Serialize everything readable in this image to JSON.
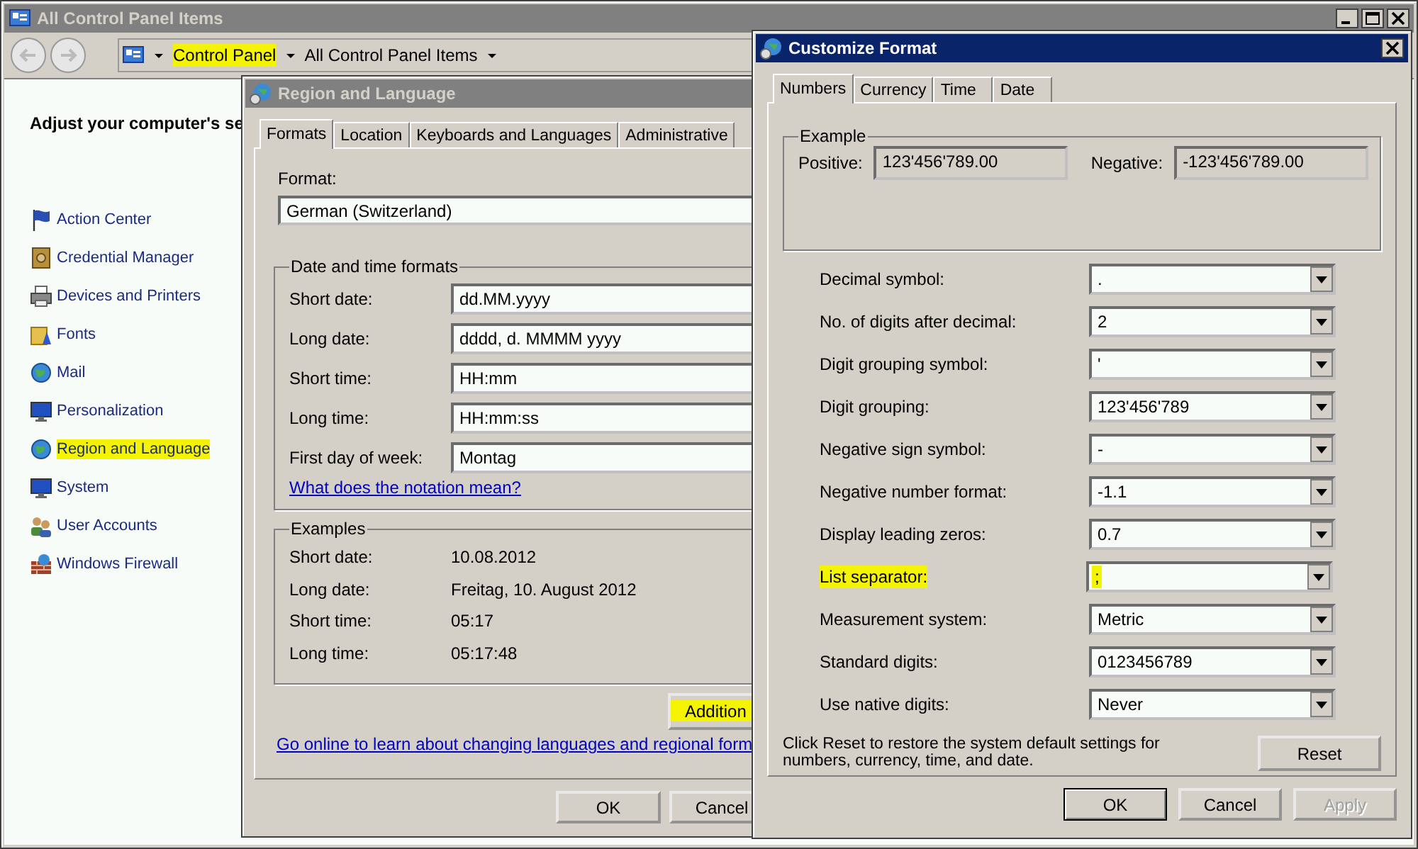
{
  "main_window": {
    "title": "All Control Panel Items",
    "active": false,
    "breadcrumb": [
      {
        "label": "Control Panel",
        "highlighted": true
      },
      {
        "label": "All Control Panel Items",
        "highlighted": false
      }
    ],
    "heading": "Adjust your computer's se",
    "items": [
      {
        "label": "Action Center",
        "highlighted": false
      },
      {
        "label": "Credential Manager",
        "highlighted": false
      },
      {
        "label": "Devices and Printers",
        "highlighted": false
      },
      {
        "label": "Fonts",
        "highlighted": false
      },
      {
        "label": "Mail",
        "highlighted": false
      },
      {
        "label": "Personalization",
        "highlighted": false
      },
      {
        "label": "Region and Language",
        "highlighted": true
      },
      {
        "label": "System",
        "highlighted": false
      },
      {
        "label": "User Accounts",
        "highlighted": false
      },
      {
        "label": "Windows Firewall",
        "highlighted": false
      }
    ]
  },
  "region_dialog": {
    "title": "Region and Language",
    "active": false,
    "tabs": [
      {
        "label": "Formats",
        "selected": true
      },
      {
        "label": "Location",
        "selected": false
      },
      {
        "label": "Keyboards and Languages",
        "selected": false
      },
      {
        "label": "Administrative",
        "selected": false
      }
    ],
    "format_label": "Format:",
    "format_value": "German (Switzerland)",
    "formats_group": {
      "title": "Date and time formats",
      "rows": [
        {
          "label": "Short date:",
          "value": "dd.MM.yyyy"
        },
        {
          "label": "Long date:",
          "value": "dddd, d. MMMM yyyy"
        },
        {
          "label": "Short time:",
          "value": "HH:mm"
        },
        {
          "label": "Long time:",
          "value": "HH:mm:ss"
        },
        {
          "label": "First day of week:",
          "value": "Montag"
        }
      ],
      "link": "What does the notation mean?"
    },
    "examples_group": {
      "title": "Examples",
      "rows": [
        {
          "label": "Short date:",
          "value": "10.08.2012"
        },
        {
          "label": "Long date:",
          "value": "Freitag, 10. August 2012"
        },
        {
          "label": "Short time:",
          "value": "05:17"
        },
        {
          "label": "Long time:",
          "value": "05:17:48"
        }
      ]
    },
    "additional_button": {
      "label": "Addition",
      "highlighted": true
    },
    "online_link": "Go online to learn about changing languages and regional form",
    "buttons": [
      {
        "label": "OK"
      },
      {
        "label": "Cancel"
      }
    ]
  },
  "customize_dialog": {
    "title": "Customize Format",
    "active": true,
    "tabs": [
      {
        "label": "Numbers",
        "selected": true
      },
      {
        "label": "Currency",
        "selected": false
      },
      {
        "label": "Time",
        "selected": false
      },
      {
        "label": "Date",
        "selected": false
      }
    ],
    "example_group": {
      "title": "Example",
      "positive_label": "Positive:",
      "positive_value": "123'456'789.00",
      "negative_label": "Negative:",
      "negative_value": "-123'456'789.00"
    },
    "settings": [
      {
        "label": "Decimal symbol:",
        "value": ".",
        "highlighted": false
      },
      {
        "label": "No. of digits after decimal:",
        "value": "2",
        "highlighted": false
      },
      {
        "label": "Digit grouping symbol:",
        "value": "'",
        "highlighted": false
      },
      {
        "label": "Digit grouping:",
        "value": "123'456'789",
        "highlighted": false
      },
      {
        "label": "Negative sign symbol:",
        "value": "-",
        "highlighted": false
      },
      {
        "label": "Negative number format:",
        "value": "-1.1",
        "highlighted": false
      },
      {
        "label": "Display leading zeros:",
        "value": "0.7",
        "highlighted": false
      },
      {
        "label": "List separator:",
        "value": ";",
        "highlighted": true
      },
      {
        "label": "Measurement system:",
        "value": "Metric",
        "highlighted": false
      },
      {
        "label": "Standard digits:",
        "value": "0123456789",
        "highlighted": false
      },
      {
        "label": "Use native digits:",
        "value": "Never",
        "highlighted": false
      }
    ],
    "reset_note": "Click Reset to restore the system default settings for numbers, currency, time, and date.",
    "reset_button": "Reset",
    "buttons": [
      {
        "label": "OK",
        "disabled": false,
        "default": true
      },
      {
        "label": "Cancel",
        "disabled": false,
        "default": false
      },
      {
        "label": "Apply",
        "disabled": true,
        "default": false
      }
    ]
  }
}
